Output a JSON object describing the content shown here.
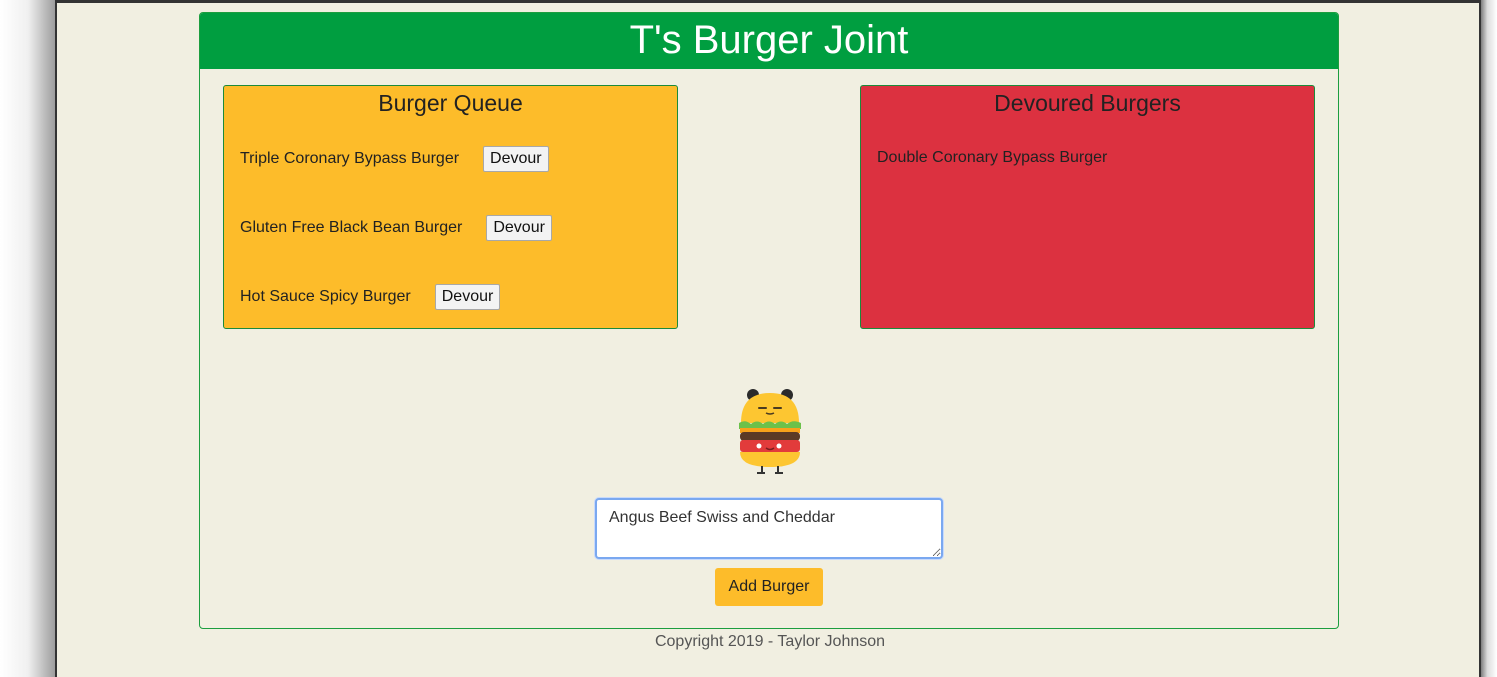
{
  "header": {
    "title": "T's Burger Joint"
  },
  "queue": {
    "title": "Burger Queue",
    "items": [
      {
        "name": "Triple Coronary Bypass Burger",
        "button": "Devour"
      },
      {
        "name": "Gluten Free Black Bean Burger",
        "button": "Devour"
      },
      {
        "name": "Hot Sauce Spicy Burger",
        "button": "Devour"
      }
    ]
  },
  "devoured": {
    "title": "Devoured Burgers",
    "items": [
      {
        "name": "Double Coronary Bypass Burger"
      }
    ]
  },
  "form": {
    "input_value": "Angus Beef Swiss and Cheddar",
    "submit_label": "Add Burger"
  },
  "footer": {
    "text": "Copyright 2019 - Taylor Johnson"
  },
  "icons": {
    "mascot": "burger-mascot-icon"
  },
  "colors": {
    "header": "#009e40",
    "queue_panel": "#fdbc2a",
    "devoured_panel": "#dc3140",
    "button_primary": "#fdbc2a"
  }
}
